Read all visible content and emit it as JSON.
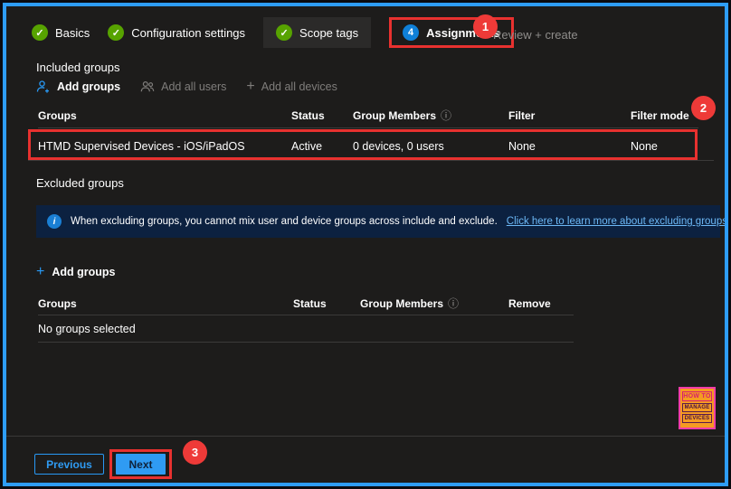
{
  "wizard": {
    "tabs": [
      {
        "label": "Basics",
        "state": "complete"
      },
      {
        "label": "Configuration settings",
        "state": "complete"
      },
      {
        "label": "Scope tags",
        "state": "complete"
      },
      {
        "label": "Assignments",
        "state": "active",
        "step": "4"
      },
      {
        "label": "Review + create",
        "state": "disabled"
      }
    ]
  },
  "annotations": {
    "step1": "1",
    "step2": "2",
    "step3": "3"
  },
  "included_groups": {
    "heading": "Included groups",
    "toolbar": {
      "add_groups": "Add groups",
      "add_all_users": "Add all users",
      "add_all_devices": "Add all devices"
    },
    "table": {
      "headers": {
        "groups": "Groups",
        "status": "Status",
        "members": "Group Members",
        "filter": "Filter",
        "filter_mode": "Filter mode"
      },
      "row": {
        "group": "HTMD Supervised Devices - iOS/iPadOS",
        "status": "Active",
        "members": "0 devices, 0 users",
        "filter": "None",
        "filter_mode": "None"
      }
    }
  },
  "excluded_groups": {
    "heading": "Excluded groups",
    "info_banner": {
      "text": "When excluding groups, you cannot mix user and device groups across include and exclude.",
      "link": "Click here to learn more about excluding groups."
    },
    "add_groups": "Add groups",
    "table": {
      "headers": {
        "groups": "Groups",
        "status": "Status",
        "members": "Group Members",
        "remove": "Remove"
      },
      "empty": "No groups selected"
    }
  },
  "footer": {
    "previous": "Previous",
    "next": "Next"
  },
  "logo": {
    "line1": "HOW TO",
    "line2": "MANAGE",
    "line3": "DEVICES"
  },
  "icons": {
    "check": "✓",
    "info": "i",
    "plus": "+",
    "member_info": "ⓘ"
  },
  "colors": {
    "accent_blue": "#2899f5",
    "success_green": "#57a300",
    "annotation_red": "#e8312f",
    "link_blue": "#6cb8f6",
    "banner_bg": "#0c2140",
    "background": "#1d1c1b",
    "frame_border": "#2e9df7"
  }
}
